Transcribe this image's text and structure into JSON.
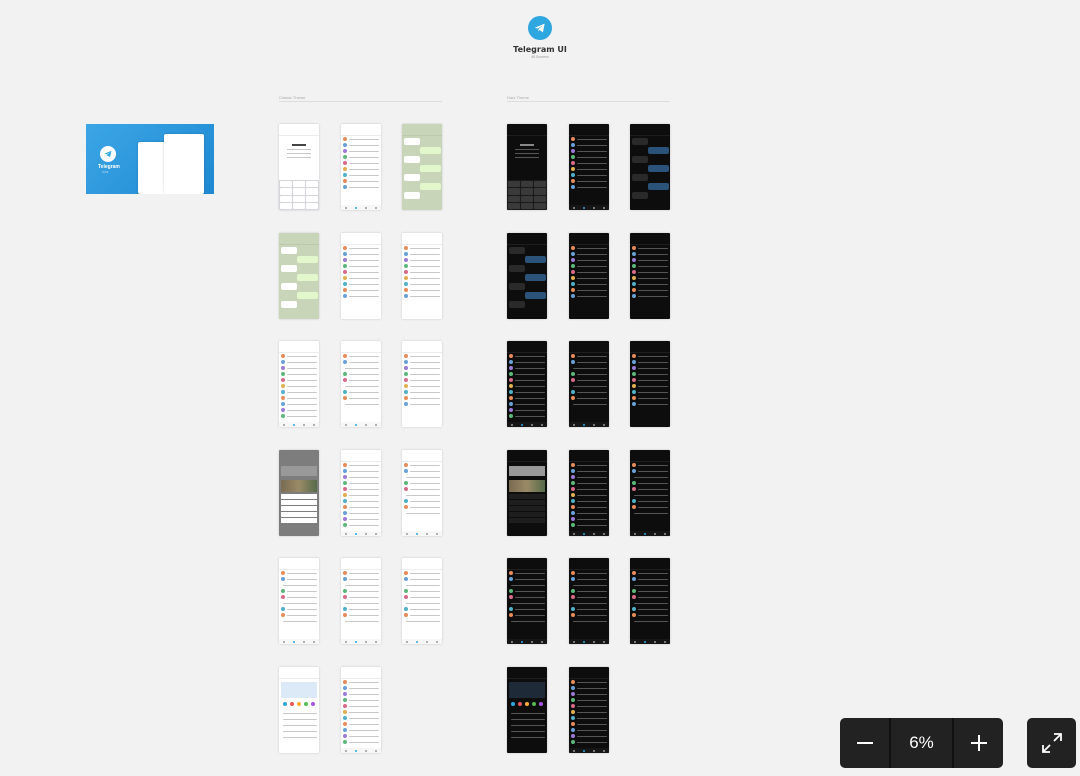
{
  "header": {
    "title": "Telegram UI",
    "subtitle": "48 Screens"
  },
  "sections": {
    "light": "Classic Theme",
    "dark": "Dark Theme"
  },
  "cover": {
    "name": "Telegram",
    "sub": "UI Kit"
  },
  "zoom": {
    "value": "6%"
  },
  "light_screens": [
    [
      "phone",
      "chats",
      "chat"
    ],
    [
      "chat",
      "profile",
      "profile"
    ],
    [
      "contacts",
      "settings",
      "edit"
    ],
    [
      "media",
      "list",
      "settings"
    ],
    [
      "settings",
      "settings",
      "settings"
    ],
    [
      "appearance",
      "list"
    ]
  ],
  "dark_screens": [
    [
      "phone",
      "chats",
      "chat"
    ],
    [
      "chat",
      "profile",
      "profile"
    ],
    [
      "contacts",
      "settings",
      "edit"
    ],
    [
      "media",
      "list",
      "settings"
    ],
    [
      "settings",
      "settings",
      "settings"
    ],
    [
      "appearance",
      "list"
    ]
  ],
  "colors": {
    "accent": "#2ea6e0",
    "dark_bg": "#0d0d0d",
    "toolbar": "#222222"
  }
}
